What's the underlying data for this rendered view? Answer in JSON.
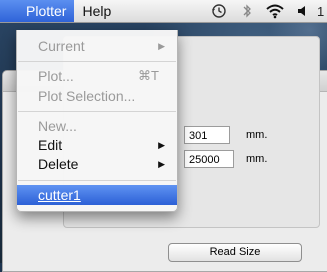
{
  "menubar": {
    "items": [
      {
        "label": "Plotter"
      },
      {
        "label": "Help"
      }
    ],
    "status_icons": [
      "time-machine-icon",
      "bluetooth-icon",
      "wifi-icon",
      "volume-icon"
    ],
    "trailing_text": "1"
  },
  "plotter_menu": {
    "items": [
      {
        "label": "Current",
        "enabled": false,
        "submenu": true
      },
      {
        "label": "Plot...",
        "enabled": false,
        "shortcut": "⌘T"
      },
      {
        "label": "Plot Selection...",
        "enabled": false
      },
      {
        "label": "New...",
        "enabled": false
      },
      {
        "label": "Edit",
        "enabled": true,
        "submenu": true
      },
      {
        "label": "Delete",
        "enabled": true,
        "submenu": true
      },
      {
        "label": "cutter1",
        "enabled": true,
        "highlighted": true
      }
    ]
  },
  "window": {
    "field_1_value": "301",
    "field_1_unit": "mm.",
    "field_2_value": "25000",
    "field_2_unit": "mm.",
    "read_size_button": "Read Size"
  },
  "colors": {
    "menu_highlight": "#2c60d6",
    "disabled_text": "#9a9a9a"
  }
}
